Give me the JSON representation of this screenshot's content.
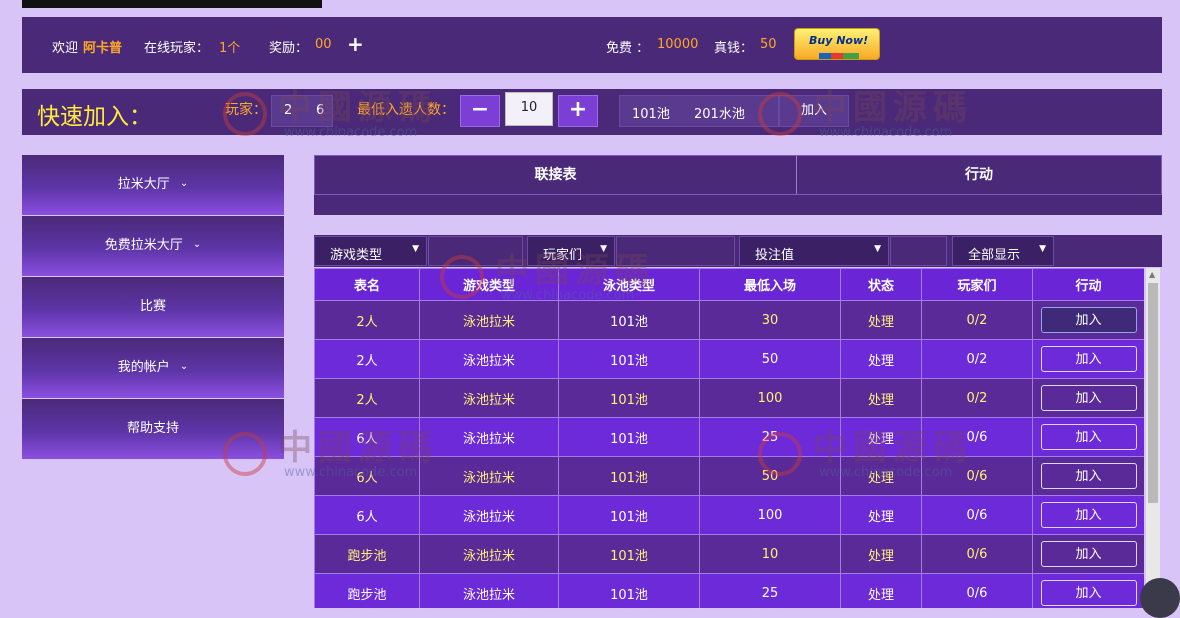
{
  "topbar": {
    "welcome_label": "欢迎",
    "username": "阿卡普",
    "online_label": "在线玩家：",
    "online_value": "1个",
    "reward_label": "奖励：",
    "reward_value": "00",
    "free_label": "免费 ：",
    "free_value": "10000",
    "real_label": "真钱：",
    "real_value": "50",
    "buy_now_label": "Buy Now!"
  },
  "quick_join": {
    "title": "快速加入：",
    "players_label": "玩家：",
    "players_options": [
      "2",
      "6"
    ],
    "min_players_label": "最低入遗人数：",
    "minus_label": "−",
    "plus_label": "+",
    "stepper_value": "10",
    "pool_options": [
      "101池",
      "201水池"
    ],
    "join_label": "加入"
  },
  "sidebar": {
    "items": [
      {
        "label": "拉米大厅",
        "has_chevron": true
      },
      {
        "label": "免费拉米大厅",
        "has_chevron": true
      },
      {
        "label": "比赛",
        "has_chevron": false
      },
      {
        "label": "我的帐户",
        "has_chevron": true
      },
      {
        "label": "帮助支持",
        "has_chevron": false
      }
    ]
  },
  "main": {
    "tabs": [
      "联接表",
      "行动"
    ],
    "filters": {
      "game_type": "游戏类型",
      "players": "玩家们",
      "bet": "投注值",
      "display": "全部显示"
    },
    "table": {
      "headers": [
        "表名",
        "游戏类型",
        "泳池类型",
        "最低入场",
        "状态",
        "玩家们",
        "行动"
      ],
      "rows": [
        {
          "name": "2人",
          "game": "泳池拉米",
          "pool": "101池",
          "min": "30",
          "status": "处理",
          "players": "0/2",
          "action": "加入",
          "yellow": true
        },
        {
          "name": "2人",
          "game": "泳池拉米",
          "pool": "101池",
          "min": "50",
          "status": "处理",
          "players": "0/2",
          "action": "加入",
          "yellow": false
        },
        {
          "name": "2人",
          "game": "泳池拉米",
          "pool": "101池",
          "min": "100",
          "status": "处理",
          "players": "0/2",
          "action": "加入",
          "yellow": true
        },
        {
          "name": "6人",
          "game": "泳池拉米",
          "pool": "101池",
          "min": "25",
          "status": "处理",
          "players": "0/6",
          "action": "加入",
          "yellow": false
        },
        {
          "name": "6人",
          "game": "泳池拉米",
          "pool": "101池",
          "min": "50",
          "status": "处理",
          "players": "0/6",
          "action": "加入",
          "yellow": true
        },
        {
          "name": "6人",
          "game": "泳池拉米",
          "pool": "101池",
          "min": "100",
          "status": "处理",
          "players": "0/6",
          "action": "加入",
          "yellow": false
        },
        {
          "name": "跑步池",
          "game": "泳池拉米",
          "pool": "101池",
          "min": "10",
          "status": "处理",
          "players": "0/6",
          "action": "加入",
          "yellow": true
        },
        {
          "name": "跑步池",
          "game": "泳池拉米",
          "pool": "101池",
          "min": "25",
          "status": "处理",
          "players": "0/6",
          "action": "加入",
          "yellow": false
        }
      ]
    }
  },
  "watermark": {
    "text": "中國源碼",
    "url": "www.chinacode.com"
  },
  "colors": {
    "background": "#d8c4f6",
    "panel": "#4a2a78",
    "header_purple": "#6a25d6",
    "accent_orange": "#ffa726",
    "accent_yellow": "#fff176"
  }
}
